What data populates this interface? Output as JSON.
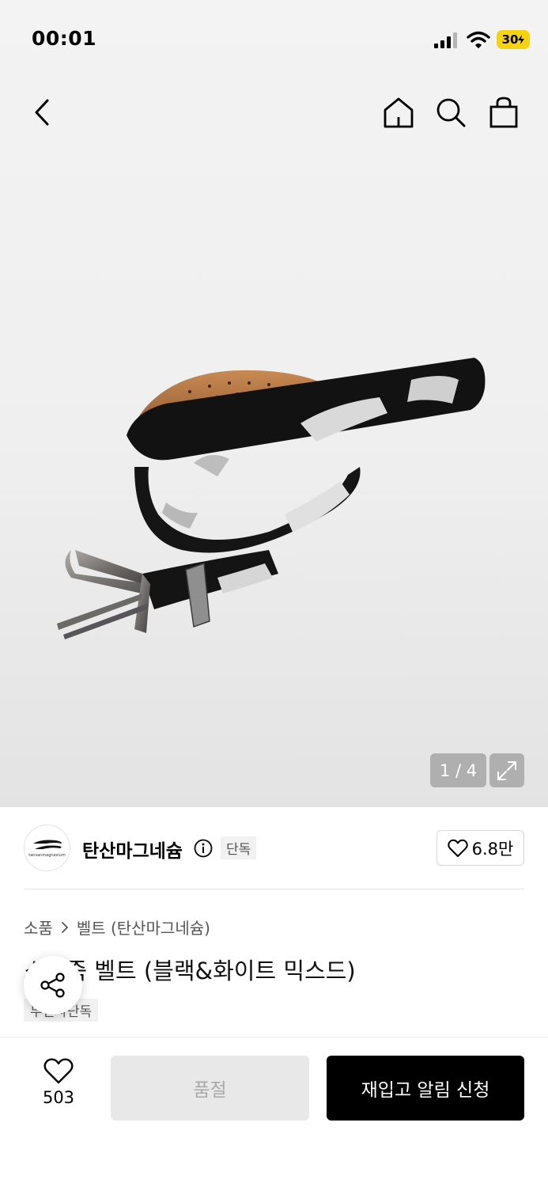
{
  "status_bar": {
    "time": "00:01",
    "battery": "30"
  },
  "nav": {
    "back_icon": "chevron-left-icon",
    "home_icon": "home-icon",
    "search_icon": "search-icon",
    "cart_icon": "shopping-bag-icon"
  },
  "gallery": {
    "counter": "1 / 4",
    "expand_icon": "expand-icon"
  },
  "brand": {
    "name": "탄산마그네슘",
    "logo_text": "tansanmagnesium",
    "exclusive_badge": "단독",
    "likes": "6.8만"
  },
  "product": {
    "breadcrumb": [
      "소품",
      "벨트 (탄산마그네슘)"
    ],
    "title": "소가죽 벨트 (블랙&화이트 믹스드)",
    "tag": "무신사단독"
  },
  "bottom_bar": {
    "wish_count": "503",
    "soldout_label": "품절",
    "restock_label": "재입고 알림 신청"
  },
  "colors": {
    "battery": "#f5d312",
    "primary_button": "#000000",
    "disabled_button": "#e8e8e8"
  }
}
